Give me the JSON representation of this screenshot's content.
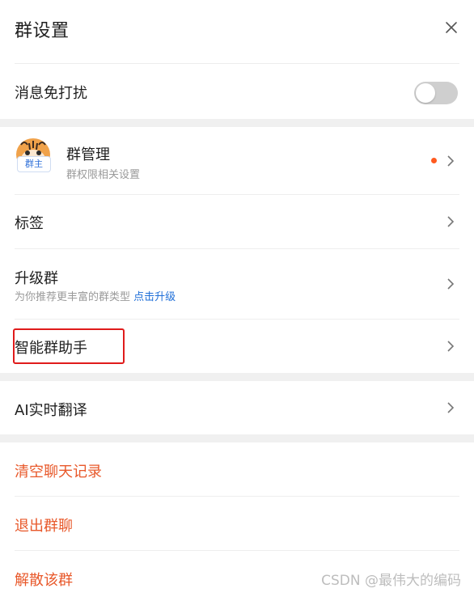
{
  "header": {
    "title": "群设置",
    "close_icon": "close-icon"
  },
  "dnd": {
    "label": "消息免打扰",
    "enabled": false
  },
  "group_manage": {
    "title": "群管理",
    "subtitle": "群权限相关设置",
    "owner_badge": "群主",
    "has_notice_dot": true,
    "dot_color": "#ff5a1f"
  },
  "tags": {
    "label": "标签"
  },
  "upgrade": {
    "label": "升级群",
    "desc": "为你推荐更丰富的群类型",
    "link": "点击升级"
  },
  "assistant": {
    "label": "智能群助手"
  },
  "translate": {
    "label": "AI实时翻译"
  },
  "danger_actions": {
    "clear": "清空聊天记录",
    "quit": "退出群聊",
    "dissolve": "解散该群",
    "color": "#e8582a"
  },
  "watermark": "CSDN @最伟大的编码"
}
